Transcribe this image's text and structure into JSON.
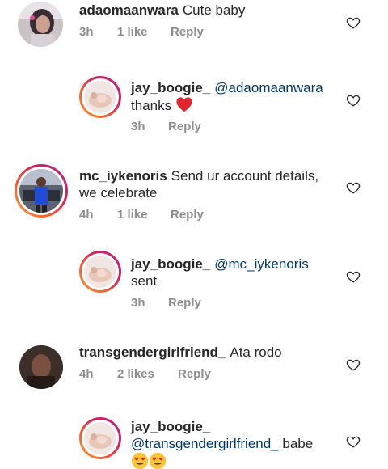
{
  "comments": [
    {
      "username": "adaomaanwara",
      "text": "Cute baby",
      "time": "3h",
      "likes": "1 like",
      "reply_label": "Reply"
    },
    {
      "username": "jay_boogie_",
      "mention": "@adaomaanwara",
      "text": "thanks",
      "emoji": "red-heart",
      "time": "3h",
      "reply_label": "Reply"
    },
    {
      "username": "mc_iykenoris",
      "text": "Send ur account  details,",
      "text_line2": "we celebrate",
      "time": "4h",
      "likes": "1 like",
      "reply_label": "Reply"
    },
    {
      "username": "jay_boogie_",
      "mention": "@mc_iykenoris",
      "text": "sent",
      "time": "3h",
      "reply_label": "Reply"
    },
    {
      "username": "transgendergirlfriend_",
      "text": "Ata rodo",
      "time": "4h",
      "likes": "2 likes",
      "reply_label": "Reply"
    },
    {
      "username": "jay_boogie_",
      "mention": "@transgendergirlfriend_",
      "text": "babe",
      "emoji": "heart-eyes-face-x2"
    }
  ],
  "colors": {
    "mention": "#00376b",
    "meta": "#8e8e8e",
    "heart_red": "#ed4956"
  },
  "icons": {
    "like": "heart-outline-icon"
  }
}
